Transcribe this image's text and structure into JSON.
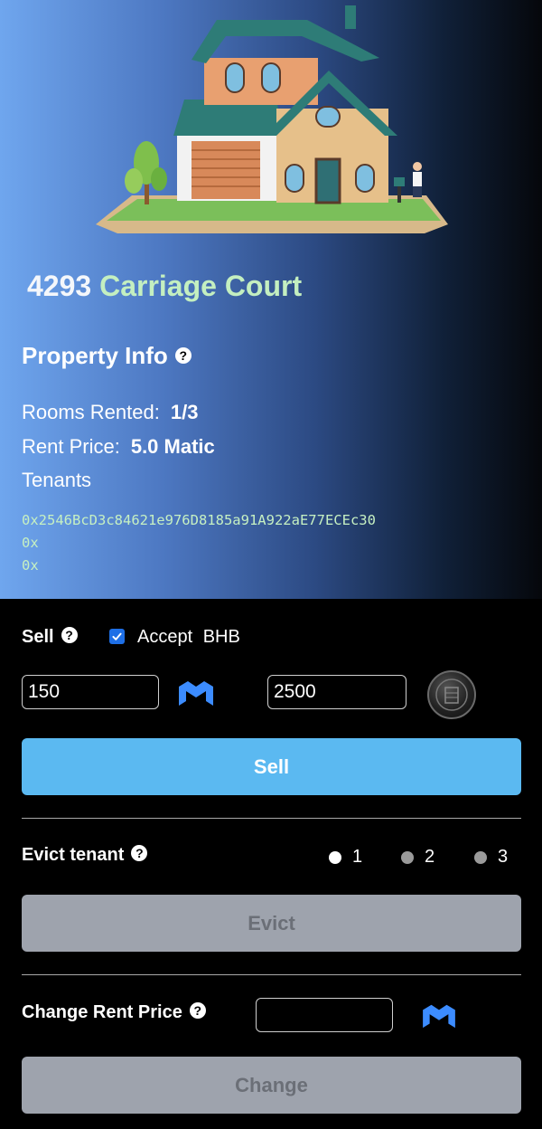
{
  "property": {
    "address_number": "4293",
    "address_street": "Carriage Court"
  },
  "info": {
    "heading": "Property Info",
    "rooms_label": "Rooms Rented:",
    "rooms_value": "1/3",
    "rent_label": "Rent Price:",
    "rent_value": "5.0 Matic",
    "tenants_label": "Tenants",
    "tenants": [
      "0x2546BcD3c84621e976D8185a91A922aE77ECEc30",
      "0x",
      "0x"
    ]
  },
  "sell": {
    "label": "Sell",
    "accept_checked": true,
    "accept_label": "Accept",
    "accept_token": "BHB",
    "matic_value": "150",
    "bhb_value": "2500",
    "button_label": "Sell"
  },
  "evict": {
    "label": "Evict tenant",
    "options": [
      "1",
      "2",
      "3"
    ],
    "selected_index": 0,
    "button_label": "Evict"
  },
  "rent_change": {
    "label": "Change Rent Price",
    "value": "",
    "button_label": "Change"
  },
  "icons": {
    "help": "question-circle-icon",
    "matic": "polygon-matic-icon",
    "coin": "bhb-coin-icon",
    "checkbox": "check-icon"
  },
  "colors": {
    "accent": "#5bb9f1",
    "address_green": "#c4efc0",
    "checkbox": "#1e6fe6",
    "disabled_button": "#9ea3ad",
    "matic": "#3c8cff"
  }
}
